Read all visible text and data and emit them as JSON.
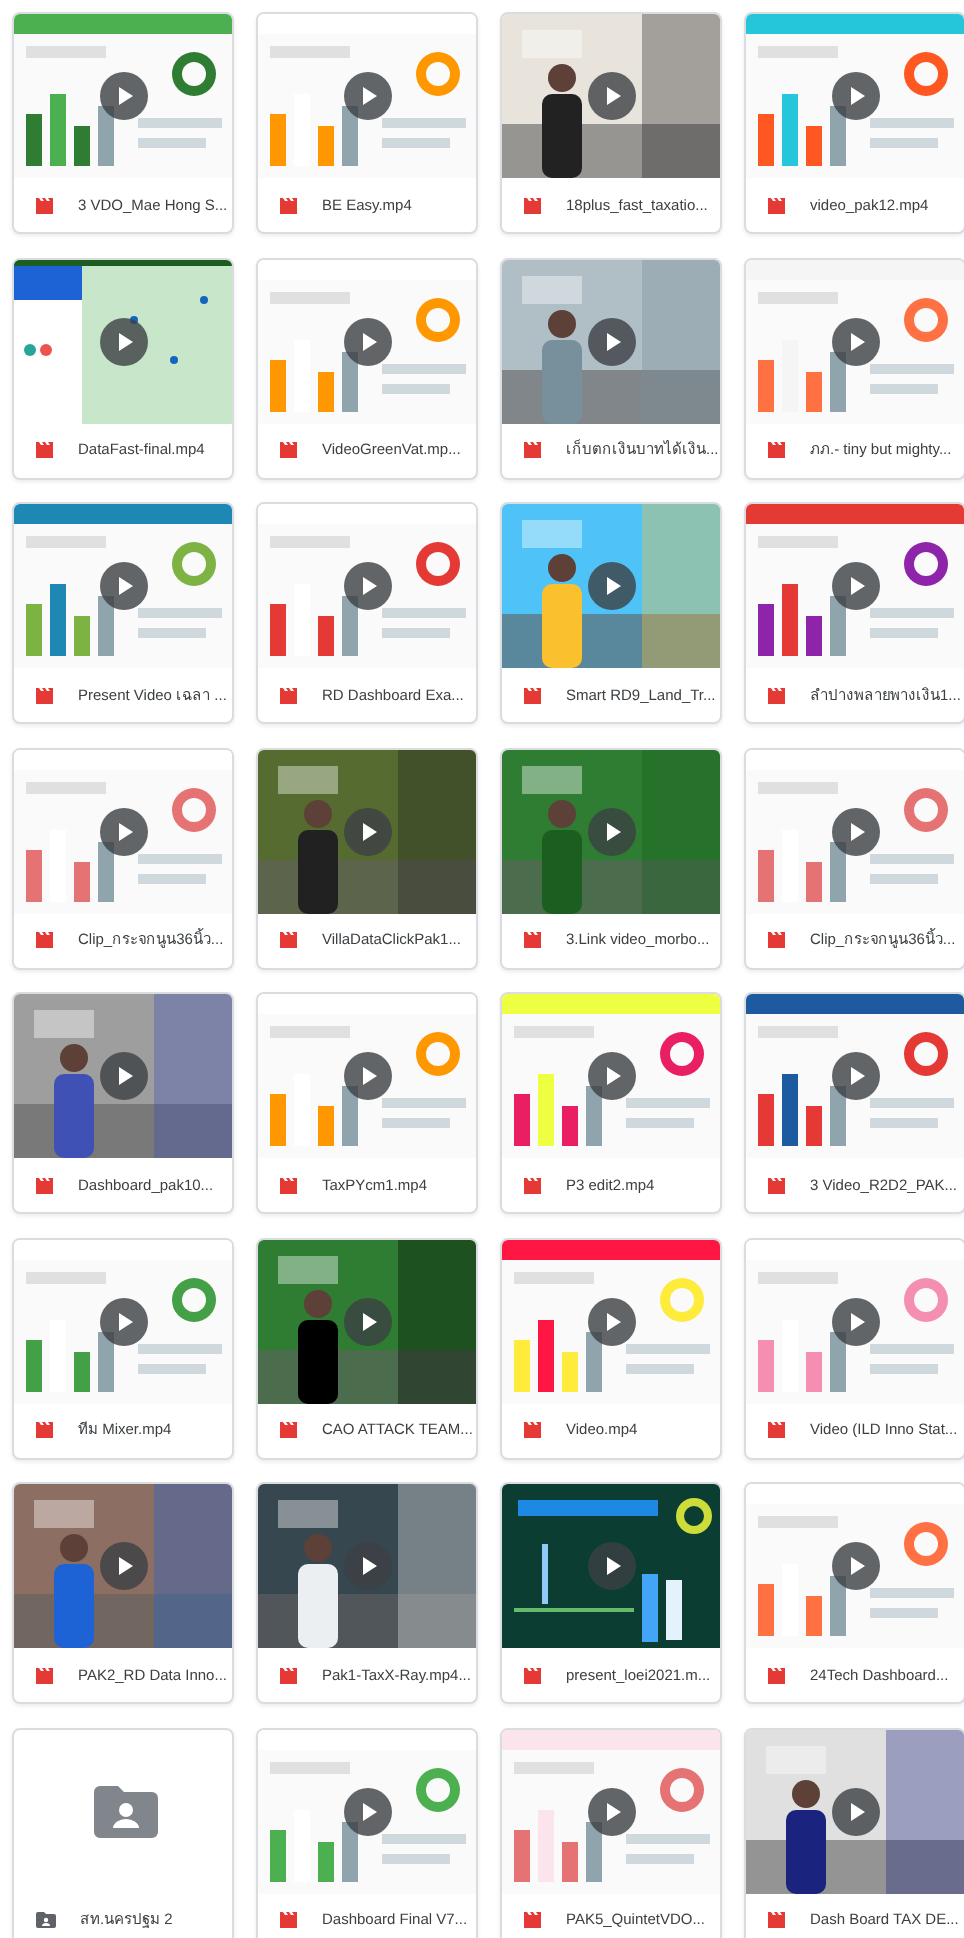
{
  "files": [
    {
      "kind": "video",
      "name": "3 VDO_Mae Hong S..."
    },
    {
      "kind": "video",
      "name": "BE Easy.mp4"
    },
    {
      "kind": "video",
      "name": "18plus_fast_taxatio..."
    },
    {
      "kind": "video",
      "name": "video_pak12.mp4"
    },
    {
      "kind": "video",
      "name": "DataFast-final.mp4"
    },
    {
      "kind": "video",
      "name": "VideoGreenVat.mp..."
    },
    {
      "kind": "video",
      "name": "เก็บตกเงินบาทได้เงิน..."
    },
    {
      "kind": "video",
      "name": "ภภ.- tiny but mighty..."
    },
    {
      "kind": "video",
      "name": "Present Video เฉลา ..."
    },
    {
      "kind": "video",
      "name": "RD Dashboard Exa..."
    },
    {
      "kind": "video",
      "name": "Smart RD9_Land_Tr..."
    },
    {
      "kind": "video",
      "name": "ลำปางพลายพางเงิน1..."
    },
    {
      "kind": "video",
      "name": "Clip_กระจกนูน36นิ้ว..."
    },
    {
      "kind": "video",
      "name": "VillaDataClickPak1..."
    },
    {
      "kind": "video",
      "name": "3.Link video_morbo..."
    },
    {
      "kind": "video",
      "name": "Clip_กระจกนูน36นิ้ว..."
    },
    {
      "kind": "video",
      "name": "Dashboard_pak10..."
    },
    {
      "kind": "video",
      "name": "TaxPYcm1.mp4"
    },
    {
      "kind": "video",
      "name": "P3 edit2.mp4"
    },
    {
      "kind": "video",
      "name": "3 Video_R2D2_PAK..."
    },
    {
      "kind": "video",
      "name": "ทีม Mixer.mp4"
    },
    {
      "kind": "video",
      "name": "CAO ATTACK TEAM..."
    },
    {
      "kind": "video",
      "name": "Video.mp4"
    },
    {
      "kind": "video",
      "name": "Video (ILD Inno Stat..."
    },
    {
      "kind": "video",
      "name": "PAK2_RD Data Inno..."
    },
    {
      "kind": "video",
      "name": "Pak1-TaxX-Ray.mp4..."
    },
    {
      "kind": "video",
      "name": "present_loei2021.m..."
    },
    {
      "kind": "video",
      "name": "24Tech Dashboard..."
    },
    {
      "kind": "folder",
      "name": "สท.นครปฐม 2"
    },
    {
      "kind": "video",
      "name": "Dashboard Final V7..."
    },
    {
      "kind": "video",
      "name": "PAK5_QuintetVDO..."
    },
    {
      "kind": "video",
      "name": "Dash Board TAX DE..."
    }
  ]
}
